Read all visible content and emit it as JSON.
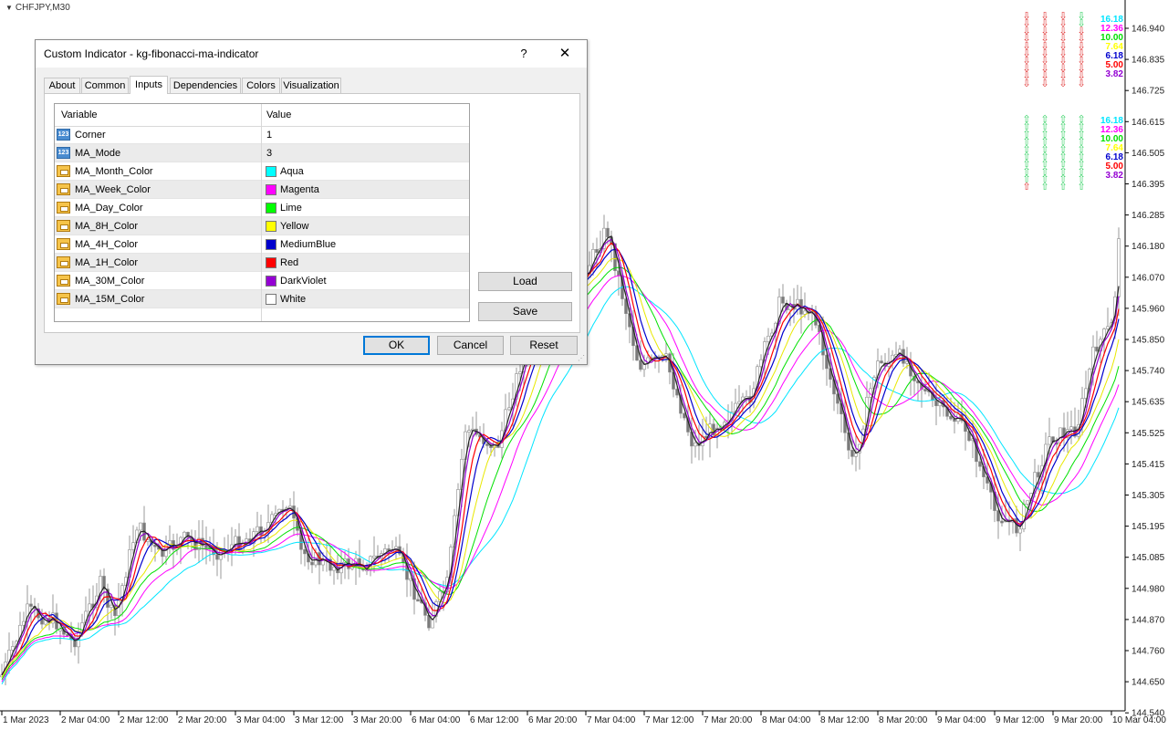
{
  "chart": {
    "symbol": "CHFJPY,M30",
    "price_ticks": [
      "146.940",
      "146.835",
      "146.725",
      "146.615",
      "146.505",
      "146.395",
      "146.285",
      "146.180",
      "146.070",
      "145.960",
      "145.850",
      "145.740",
      "145.635",
      "145.525",
      "145.415",
      "145.305",
      "145.195",
      "145.085",
      "144.980",
      "144.870",
      "144.760",
      "144.650",
      "144.540"
    ],
    "time_ticks": [
      "1 Mar 2023",
      "2 Mar 04:00",
      "2 Mar 12:00",
      "2 Mar 20:00",
      "3 Mar 04:00",
      "3 Mar 12:00",
      "3 Mar 20:00",
      "6 Mar 04:00",
      "6 Mar 12:00",
      "6 Mar 20:00",
      "7 Mar 04:00",
      "7 Mar 12:00",
      "7 Mar 20:00",
      "8 Mar 04:00",
      "8 Mar 12:00",
      "8 Mar 20:00",
      "9 Mar 04:00",
      "9 Mar 12:00",
      "9 Mar 20:00",
      "10 Mar 04:00"
    ],
    "fib_top": [
      {
        "text": "16.18",
        "color": "#00e5ff"
      },
      {
        "text": "12.36",
        "color": "#ff00ff"
      },
      {
        "text": "10.00",
        "color": "#00e000"
      },
      {
        "text": "7.64",
        "color": "#ffff00"
      },
      {
        "text": "6.18",
        "color": "#0000cd"
      },
      {
        "text": "5.00",
        "color": "#ff0000"
      },
      {
        "text": "3.82",
        "color": "#9400d3"
      }
    ],
    "fib_bottom": [
      {
        "text": "16.18",
        "color": "#00e5ff"
      },
      {
        "text": "12.36",
        "color": "#ff00ff"
      },
      {
        "text": "10.00",
        "color": "#00e000"
      },
      {
        "text": "7.64",
        "color": "#ffff00"
      },
      {
        "text": "6.18",
        "color": "#0000cd"
      },
      {
        "text": "5.00",
        "color": "#ff0000"
      },
      {
        "text": "3.82",
        "color": "#9400d3"
      }
    ],
    "arrow_top_color": "#e03030",
    "arrow_bottom_color": "#30d060",
    "ma_colors": [
      "#00e5ff",
      "#ff00ff",
      "#00e000",
      "#e8e800",
      "#0000cd",
      "#ff0000",
      "#9400d3",
      "#222222"
    ]
  },
  "dialog": {
    "title": "Custom Indicator - kg-fibonacci-ma-indicator",
    "help": "?",
    "close": "✕",
    "tabs": [
      {
        "label": "About"
      },
      {
        "label": "Common"
      },
      {
        "label": "Inputs"
      },
      {
        "label": "Dependencies"
      },
      {
        "label": "Colors"
      },
      {
        "label": "Visualization"
      }
    ],
    "active_tab": "Inputs",
    "grid": {
      "col_variable": "Variable",
      "col_value": "Value",
      "rows": [
        {
          "name": "Corner",
          "value": "1",
          "type": "int"
        },
        {
          "name": "MA_Mode",
          "value": "3",
          "type": "int"
        },
        {
          "name": "MA_Month_Color",
          "value": "Aqua",
          "type": "color",
          "swatch": "#00ffff"
        },
        {
          "name": "MA_Week_Color",
          "value": "Magenta",
          "type": "color",
          "swatch": "#ff00ff"
        },
        {
          "name": "MA_Day_Color",
          "value": "Lime",
          "type": "color",
          "swatch": "#00ff00"
        },
        {
          "name": "MA_8H_Color",
          "value": "Yellow",
          "type": "color",
          "swatch": "#ffff00"
        },
        {
          "name": "MA_4H_Color",
          "value": "MediumBlue",
          "type": "color",
          "swatch": "#0000cd"
        },
        {
          "name": "MA_1H_Color",
          "value": "Red",
          "type": "color",
          "swatch": "#ff0000"
        },
        {
          "name": "MA_30M_Color",
          "value": "DarkViolet",
          "type": "color",
          "swatch": "#9400d3"
        },
        {
          "name": "MA_15M_Color",
          "value": "White",
          "type": "color",
          "swatch": "#ffffff"
        }
      ]
    },
    "load": "Load",
    "save": "Save",
    "ok": "OK",
    "cancel": "Cancel",
    "reset": "Reset",
    "icon_int_label": "123"
  }
}
